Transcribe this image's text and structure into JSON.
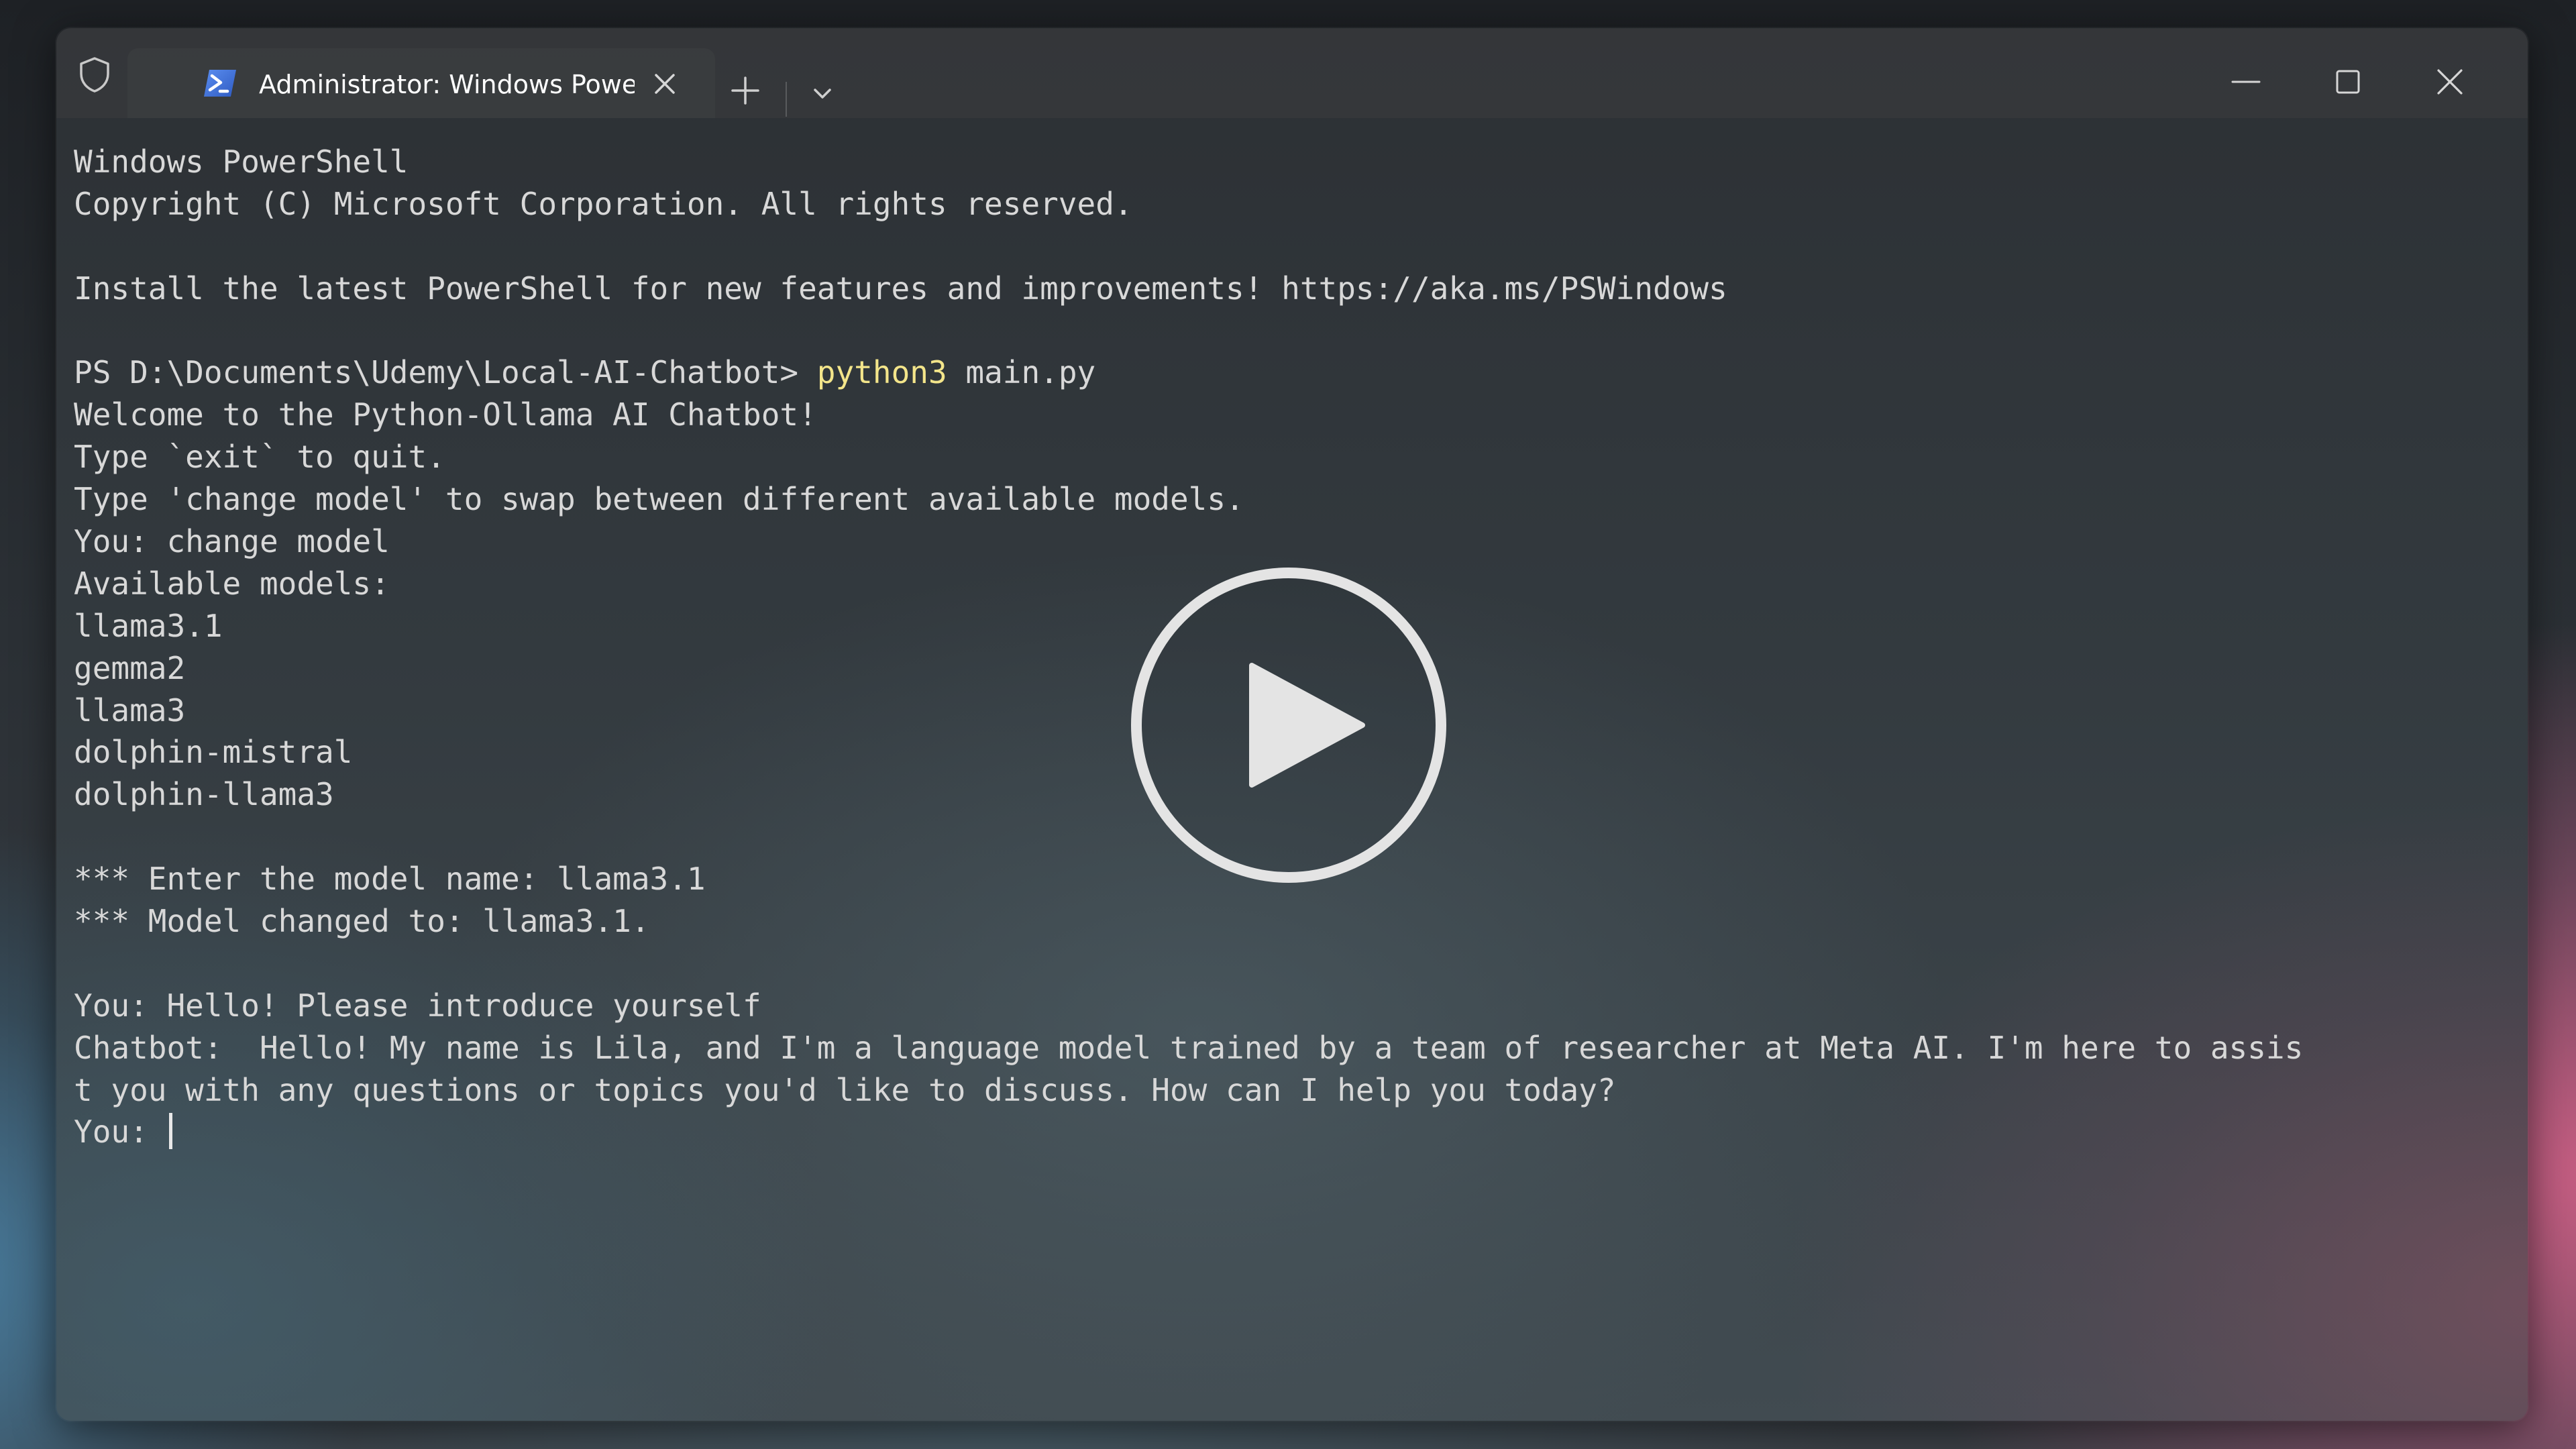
{
  "window": {
    "tab_title": "Administrator: Windows Powe",
    "tab_icon": "powershell-icon",
    "titlebar_icons": [
      "shield-icon",
      "close-icon",
      "plus-icon",
      "chevron-down-icon",
      "minimize-icon",
      "maximize-icon",
      "close-icon"
    ]
  },
  "terminal": {
    "header": [
      "Windows PowerShell",
      "Copyright (C) Microsoft Corporation. All rights reserved.",
      "",
      "Install the latest PowerShell for new features and improvements! https://aka.ms/PSWindows",
      ""
    ],
    "prompt": "PS D:\\Documents\\Udemy\\Local-AI-Chatbot>",
    "command": "python3",
    "command_args": "main.py",
    "output": [
      "Welcome to the Python-Ollama AI Chatbot!",
      "Type `exit` to quit.",
      "Type 'change model' to swap between different available models.",
      "You: change model",
      "Available models:",
      "llama3.1",
      "gemma2",
      "llama3",
      "dolphin-mistral",
      "dolphin-llama3",
      "",
      "*** Enter the model name: llama3.1",
      "*** Model changed to: llama3.1.",
      "",
      "You: Hello! Please introduce yourself",
      "Chatbot:  Hello! My name is Lila, and I'm a language model trained by a team of researcher at Meta AI. I'm here to assis",
      "t you with any questions or topics you'd like to discuss. How can I help you today?"
    ],
    "current_prompt": "You: "
  },
  "overlay": {
    "play_icon": "play-icon"
  },
  "colors": {
    "command_highlight": "#f3e58a",
    "terminal_text": "#d8d8d8",
    "accent_blue": "#3e6fd8"
  }
}
